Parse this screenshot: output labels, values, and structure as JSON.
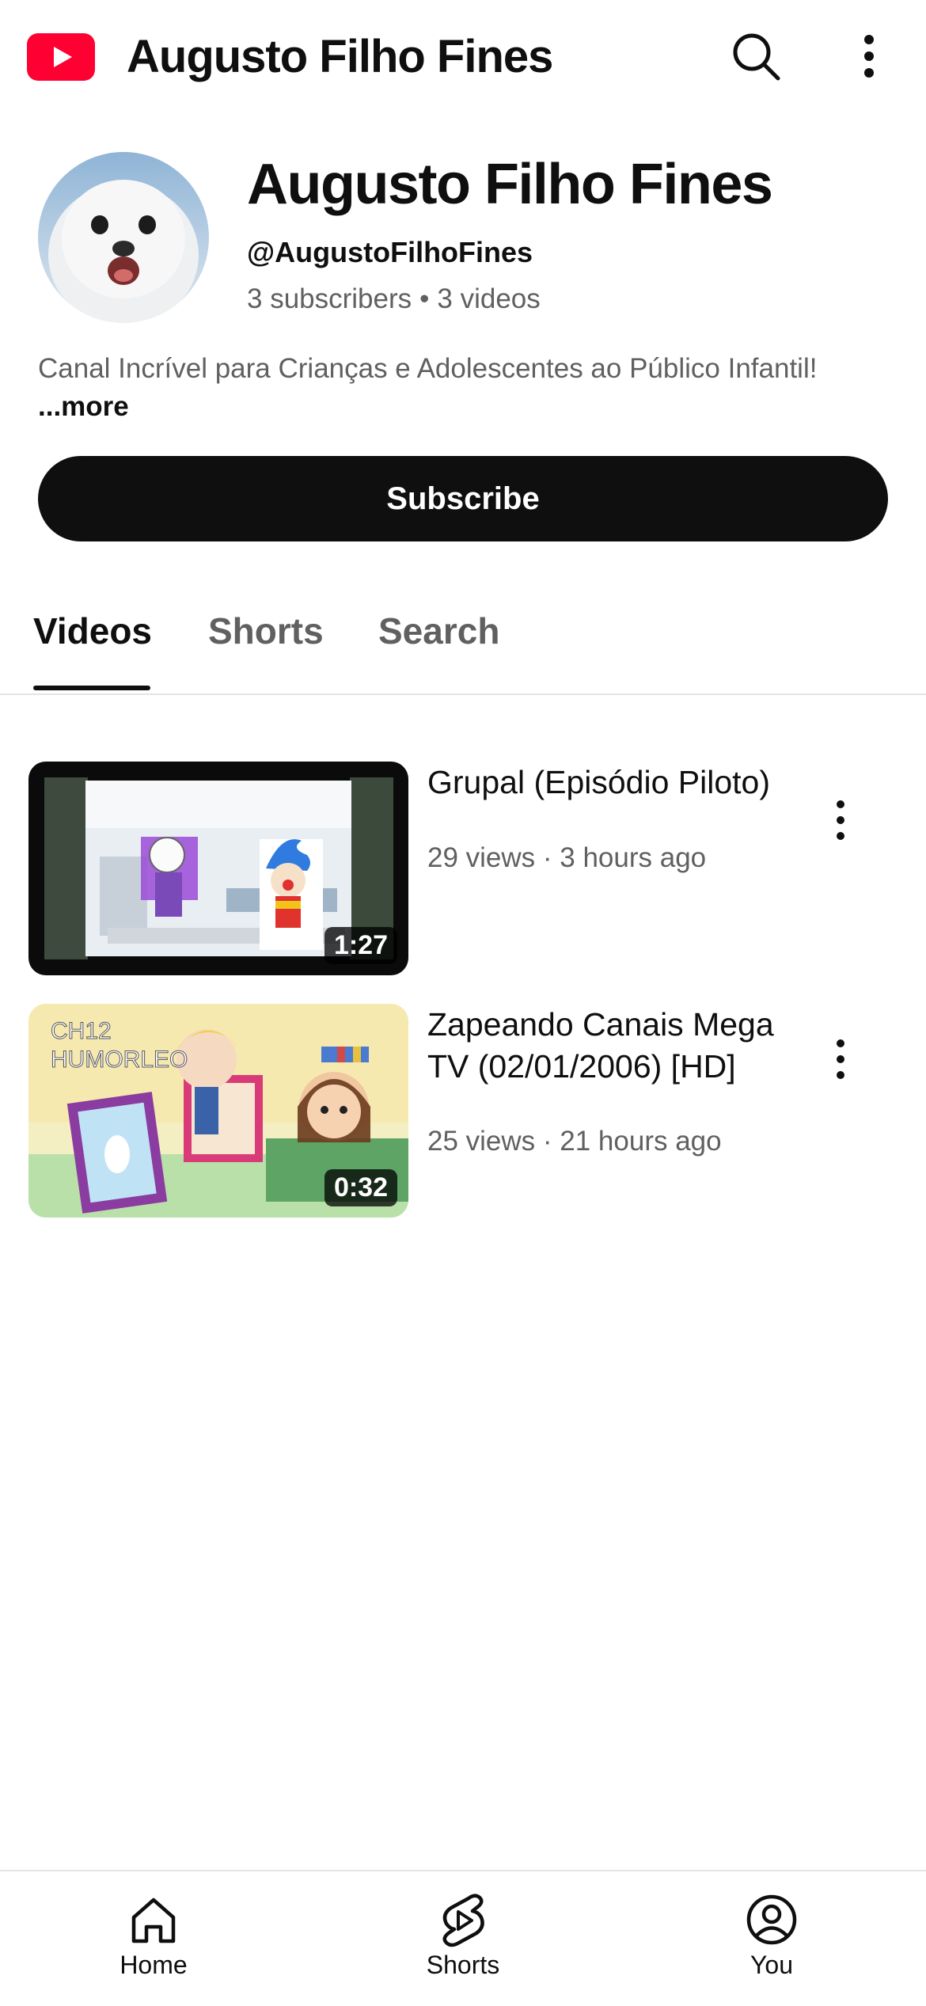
{
  "app": {
    "title": "Augusto Filho Fines",
    "brand_color": "#ff0033"
  },
  "channel": {
    "name": "Augusto Filho Fines",
    "handle": "@AugustoFilhoFines",
    "subscribers": "3 subscribers",
    "videos_count": "3 videos",
    "description": "Canal Incrível para Crianças e Adolescentes ao Público Infantil!",
    "more_label": "...more",
    "subscribe_label": "Subscribe"
  },
  "tabs": [
    {
      "label": "Videos",
      "active": true
    },
    {
      "label": "Shorts",
      "active": false
    },
    {
      "label": "Search",
      "active": false
    }
  ],
  "videos": [
    {
      "title": "Grupal (Episódio Piloto)",
      "meta": "29 views · 3 hours ago",
      "duration": "1:27"
    },
    {
      "title": "Zapeando Canais Mega TV (02/01/2006) [HD]",
      "meta": "25 views · 21 hours ago",
      "duration": "0:32",
      "thumb_overlay": "CH12\nHUMORLEO"
    }
  ],
  "bottom_nav": [
    {
      "label": "Home",
      "icon": "home-icon"
    },
    {
      "label": "Shorts",
      "icon": "shorts-icon"
    },
    {
      "label": "You",
      "icon": "account-icon"
    }
  ]
}
